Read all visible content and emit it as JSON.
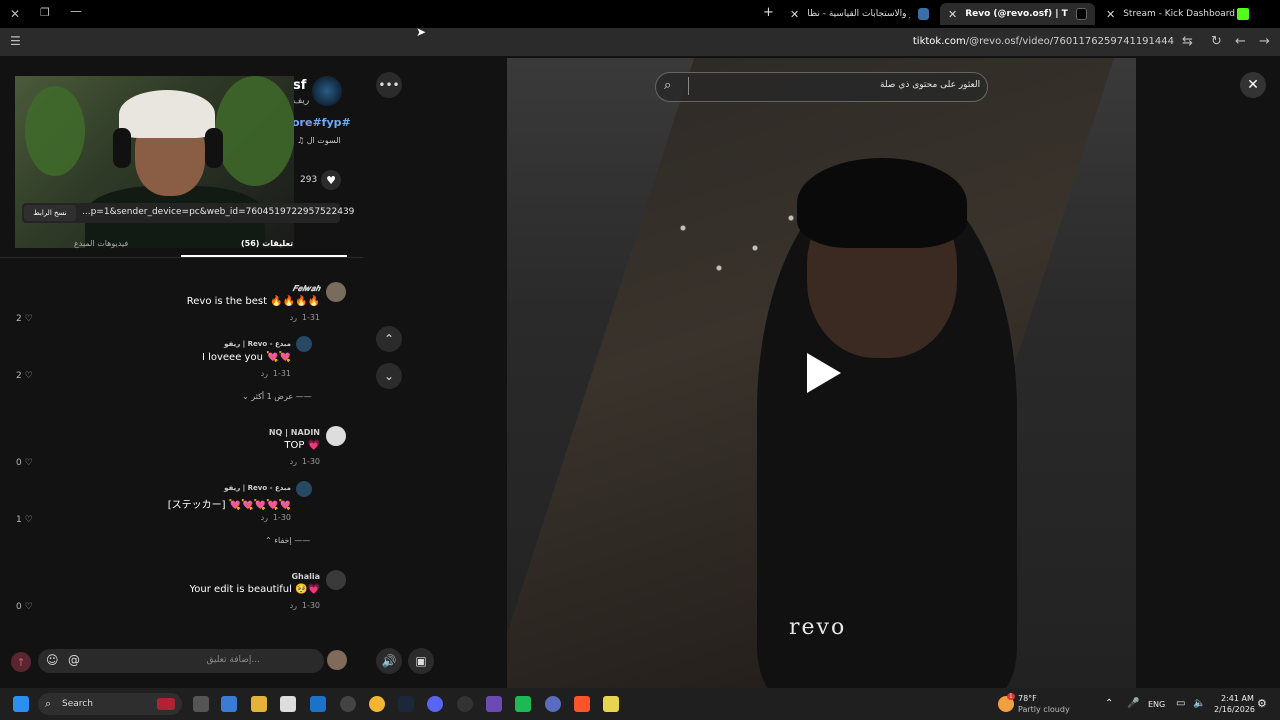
{
  "browser": {
    "tabs": [
      {
        "title": "الأوامر والاستجابات القياسية - نظا",
        "active": false
      },
      {
        "title": "Revo (@revo.osf) | TikTok | ريفو",
        "active": true
      },
      {
        "title": "Stream - Kick Dashboard",
        "active": false
      }
    ],
    "url_domain": "tiktok.com",
    "url_path": "/@revo.osf/video/7601176259741191444"
  },
  "post": {
    "author_name": "sf",
    "author_sub": "ريف",
    "hashtags": "ore#fyp#",
    "sound": "♫ السوت ال",
    "like_count": "293",
    "copy_link_label": "نسخ الرابط",
    "link_text": "...p=1&sender_device=pc&web_id=7604519722957522439"
  },
  "comment_tabs": {
    "comments": "تعليقات (56)",
    "creator_videos": "فيديوهات المبدع"
  },
  "comments": [
    {
      "name": "𝑭𝒆𝒍𝒘𝒂𝒉",
      "text": "Revo is the best 🔥🔥🔥🔥",
      "date": "1-31",
      "reply": "رد",
      "likes": "2"
    },
    {
      "name": "ريفو | Revo - مبدع",
      "text": "I loveee you 💘💘",
      "date": "1-31",
      "reply": "رد",
      "likes": "2"
    },
    {
      "name": "NQ | NADIN",
      "text": "TOP 💗",
      "date": "1-30",
      "reply": "رد",
      "likes": "0"
    },
    {
      "name": "ريفو | Revo - مبدع",
      "text": "[ステッカー] 💘💘💘💘💘",
      "date": "1-30",
      "reply": "رد",
      "likes": "1"
    },
    {
      "name": "Ghalia",
      "text": "Your edit is beautiful 🥺💗",
      "date": "1-30",
      "reply": "رد",
      "likes": "0"
    }
  ],
  "view_more": "عرض 1 أكثر",
  "hide": "إخفاء",
  "comment_input_placeholder": "إضافة تعليق...",
  "video": {
    "search_placeholder": "العثور على محتوى ذي صلة",
    "watermark": "revo"
  },
  "taskbar": {
    "search_label": "Search",
    "weather_temp": "78°F",
    "weather_desc": "Partly cloudy",
    "lang": "ENG",
    "time": "2:41 AM",
    "date": "2/16/2026",
    "weather_badge": "1"
  },
  "colors": {
    "accent_link": "#6ea8ff",
    "like_heart": "#ff3b5c"
  }
}
